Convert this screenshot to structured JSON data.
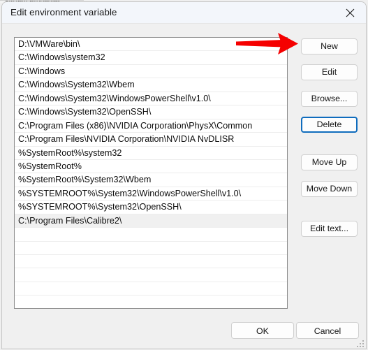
{
  "background_window": {
    "title_fragment": "System Properties"
  },
  "dialog": {
    "title": "Edit environment variable",
    "close_icon": "close-icon"
  },
  "list": {
    "items": [
      "D:\\VMWare\\bin\\",
      "C:\\Windows\\system32",
      "C:\\Windows",
      "C:\\Windows\\System32\\Wbem",
      "C:\\Windows\\System32\\WindowsPowerShell\\v1.0\\",
      "C:\\Windows\\System32\\OpenSSH\\",
      "C:\\Program Files (x86)\\NVIDIA Corporation\\PhysX\\Common",
      "C:\\Program Files\\NVIDIA Corporation\\NVIDIA NvDLISR",
      "%SystemRoot%\\system32",
      "%SystemRoot%",
      "%SystemRoot%\\System32\\Wbem",
      "%SYSTEMROOT%\\System32\\WindowsPowerShell\\v1.0\\",
      "%SYSTEMROOT%\\System32\\OpenSSH\\",
      "C:\\Program Files\\Calibre2\\"
    ],
    "selected_index": 13,
    "empty_row_count": 6
  },
  "side_buttons": {
    "new": "New",
    "edit": "Edit",
    "browse": "Browse...",
    "delete": "Delete",
    "move_up": "Move Up",
    "move_down": "Move Down",
    "edit_text": "Edit text...",
    "focused": "delete"
  },
  "bottom_buttons": {
    "ok": "OK",
    "cancel": "Cancel"
  },
  "annotation": {
    "arrow_color": "#f50000",
    "arrow_points_to": "New",
    "arrow_name": "red-arrow-annotation"
  },
  "colors": {
    "dialog_background": "#f0f0f0",
    "titlebar_background": "#f3f6fb",
    "listbox_background": "#ffffff",
    "selection_background": "#f0f0f0",
    "focus_border": "#0f6cbd",
    "accent_red": "#f50000"
  }
}
